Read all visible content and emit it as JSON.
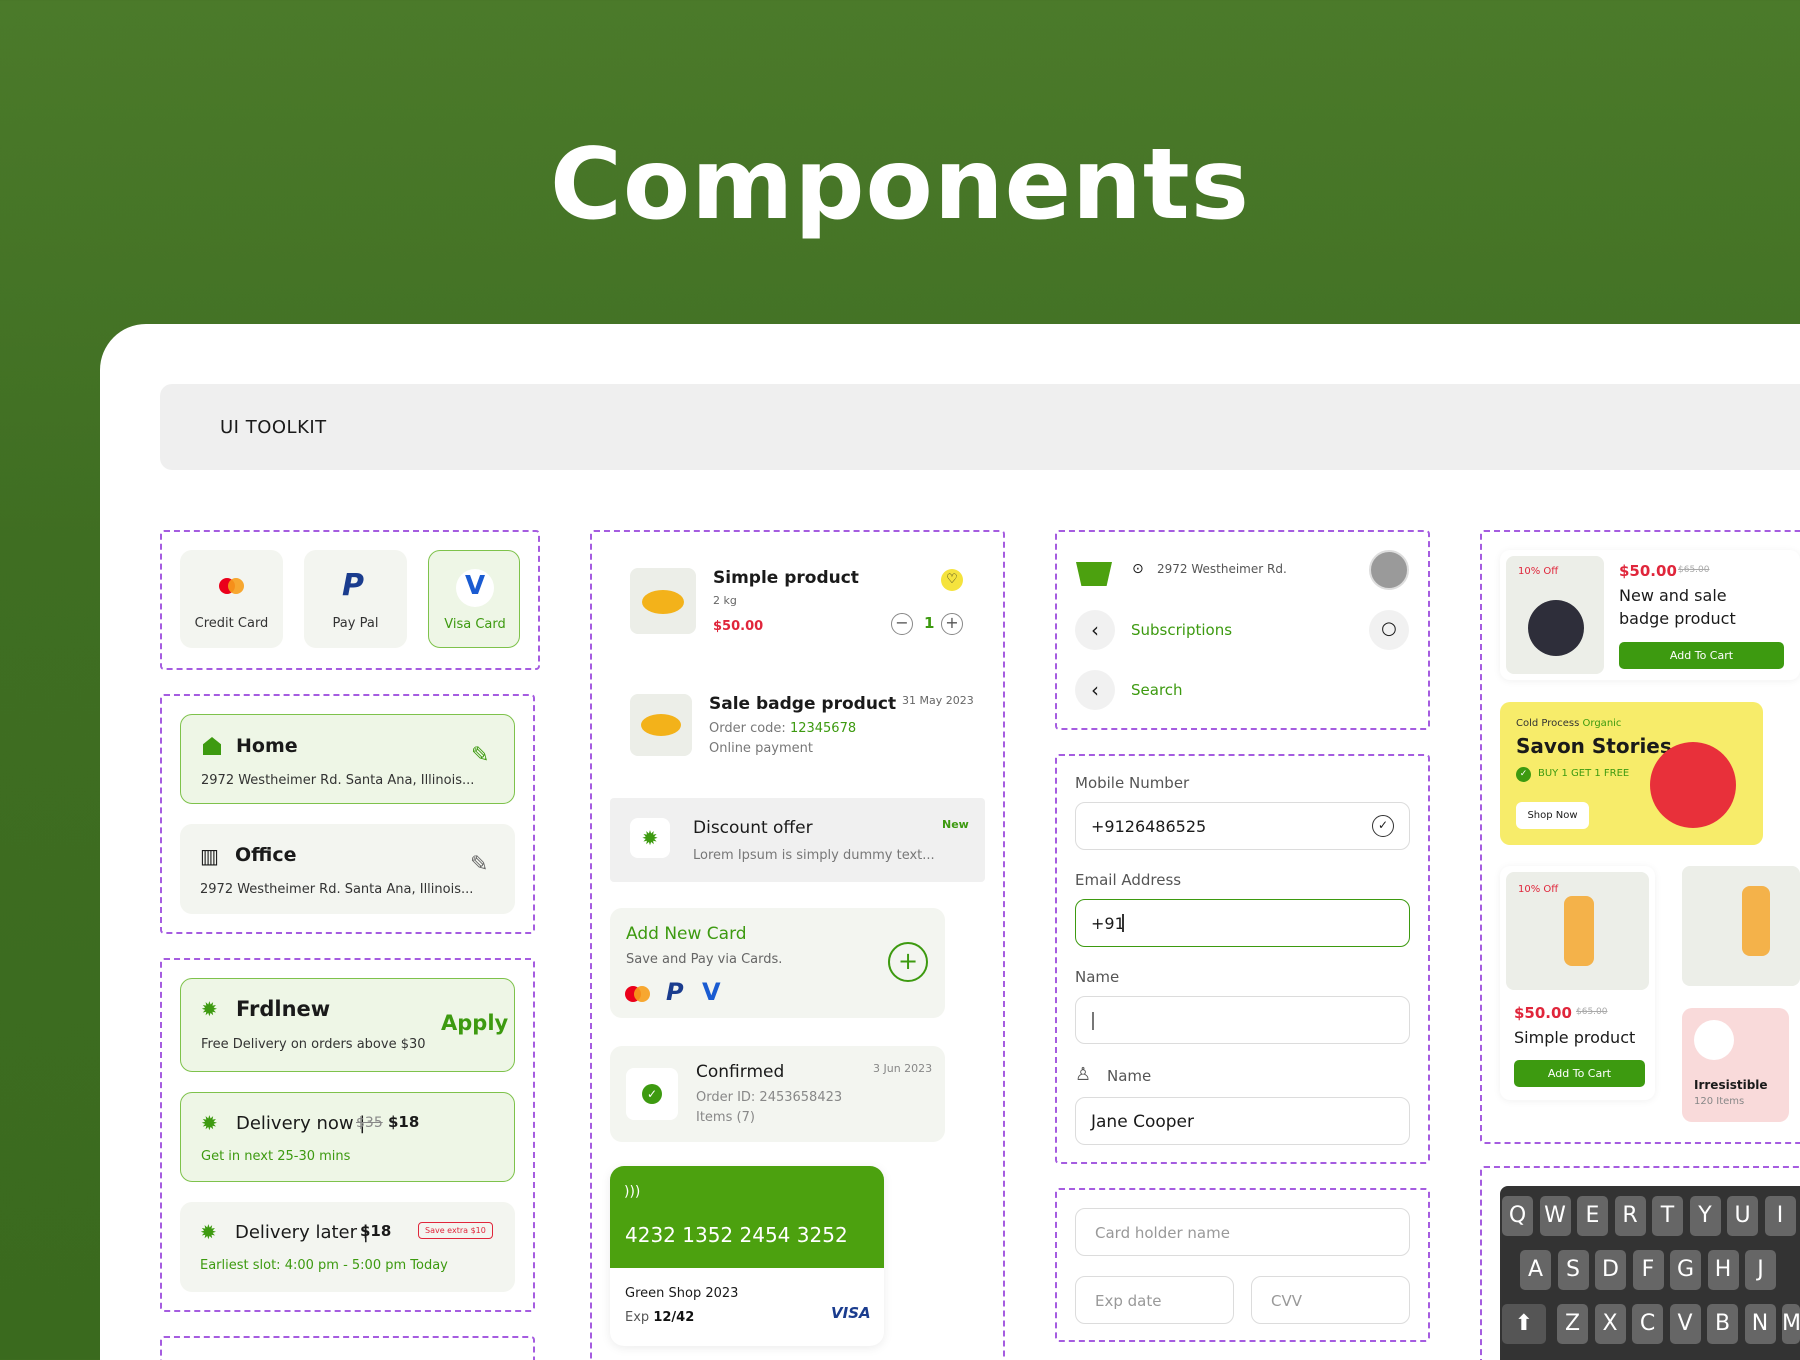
{
  "page_title": "Components",
  "toolkit_label": "UI TOOLKIT",
  "payment": [
    {
      "label": "Credit Card"
    },
    {
      "label": "Pay Pal"
    },
    {
      "label": "Visa Card"
    }
  ],
  "address": [
    {
      "title": "Home",
      "text": "2972 Westheimer Rd. Santa Ana, Illinois..."
    },
    {
      "title": "Office",
      "text": "2972 Westheimer Rd. Santa Ana, Illinois..."
    }
  ],
  "coupon": {
    "code": "Frdlnew",
    "desc": "Free Delivery on orders above $30",
    "apply": "Apply"
  },
  "delivery_now": {
    "title": "Delivery now |",
    "old": "$35",
    "price": "$18",
    "sub": "Get in next 25-30 mins"
  },
  "delivery_later": {
    "title": "Delivery later |",
    "price": "$18",
    "badge": "Save extra $10",
    "sub": "Earliest slot: 4:00 pm - 5:00 pm Today"
  },
  "cart_item": {
    "name": "Simple product",
    "weight": "2 kg",
    "price": "$50.00",
    "qty": "1"
  },
  "order_item": {
    "name": "Sale badge product",
    "date": "31 May 2023",
    "code_label": "Order code:",
    "code": "12345678",
    "payment": "Online payment"
  },
  "discount": {
    "title": "Discount offer",
    "badge": "New",
    "text": "Lorem Ipsum is simply dummy text..."
  },
  "add_card": {
    "title": "Add New Card",
    "sub": "Save and Pay via Cards."
  },
  "confirmed": {
    "title": "Confirmed",
    "date": "3 Jun 2023",
    "order": "Order ID: 2453658423",
    "items": "Items (7)"
  },
  "bank_card": {
    "number": "4232 1352 2454 3252",
    "holder": "Green Shop 2023",
    "exp_label": "Exp",
    "exp": "12/42",
    "brand": "VISA"
  },
  "header": {
    "address": "2972 Westheimer Rd.",
    "nav1": "Subscriptions",
    "nav2": "Search"
  },
  "form": {
    "mobile_label": "Mobile Number",
    "mobile_value": "+9126486525",
    "email_label": "Email Address",
    "email_value": "+91",
    "name_label": "Name",
    "name2_label": "Name",
    "name2_value": "Jane Cooper"
  },
  "card_form": {
    "holder": "Card holder name",
    "exp": "Exp date",
    "cvv": "CVV"
  },
  "product1": {
    "badge": "10% Off",
    "price": "$50.00",
    "old": "$65.00",
    "name1": "New and sale",
    "name2": "badge product",
    "button": "Add To Cart"
  },
  "promo": {
    "pre": "Cold Process",
    "pre2": "Organic",
    "title": "Savon Stories",
    "offer": "BUY 1 GET 1 FREE",
    "button": "Shop Now"
  },
  "product2": {
    "badge": "10% Off",
    "price": "$50.00",
    "old": "$65.00",
    "name": "Simple product",
    "button": "Add To Cart"
  },
  "category": {
    "name": "Irresistible",
    "count": "120 Items"
  },
  "keyboard": {
    "row1": [
      "Q",
      "W",
      "E",
      "R",
      "T",
      "Y",
      "U",
      "I"
    ],
    "row2": [
      "A",
      "S",
      "D",
      "F",
      "G",
      "H",
      "J"
    ],
    "row3": [
      "Z",
      "X",
      "C",
      "V",
      "B",
      "N",
      "M"
    ]
  },
  "colors": {
    "accent": "#3d9a10",
    "bg": "#3f6e22",
    "dash": "#a55ce0"
  }
}
